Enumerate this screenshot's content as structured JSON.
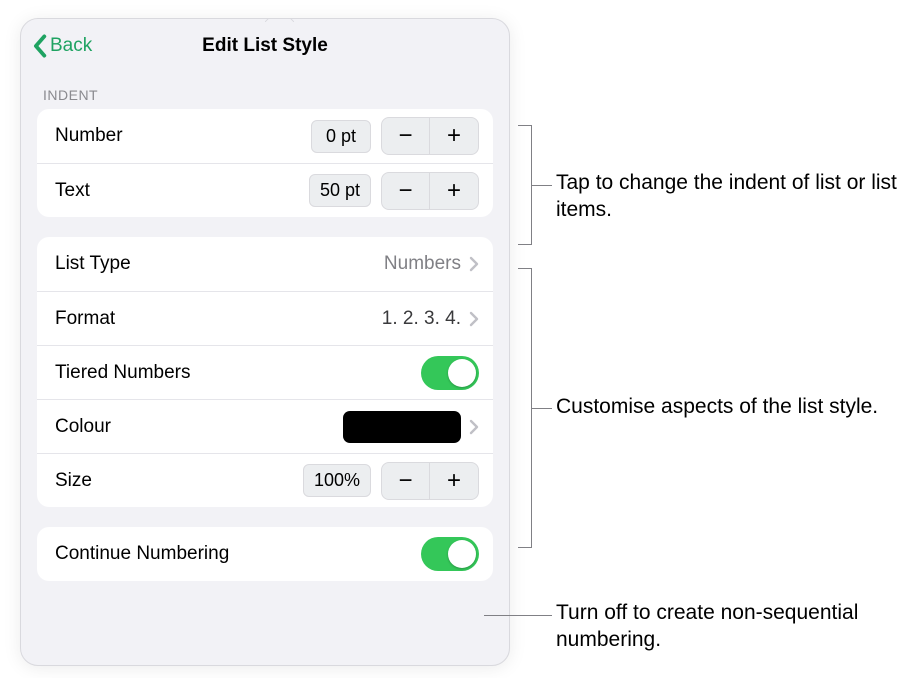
{
  "nav": {
    "back": "Back",
    "title": "Edit List Style"
  },
  "indent": {
    "header": "Indent",
    "number_label": "Number",
    "number_value": "0 pt",
    "text_label": "Text",
    "text_value": "50 pt"
  },
  "style": {
    "list_type_label": "List Type",
    "list_type_value": "Numbers",
    "format_label": "Format",
    "format_value": "1. 2. 3. 4.",
    "tiered_label": "Tiered Numbers",
    "colour_label": "Colour",
    "size_label": "Size",
    "size_value": "100%"
  },
  "continue": {
    "label": "Continue Numbering"
  },
  "callouts": {
    "indent": "Tap to change the indent of list or list items.",
    "custom": "Customise aspects of the list style.",
    "continue": "Turn off to create non-sequential numbering."
  },
  "glyphs": {
    "minus": "−",
    "plus": "+"
  }
}
